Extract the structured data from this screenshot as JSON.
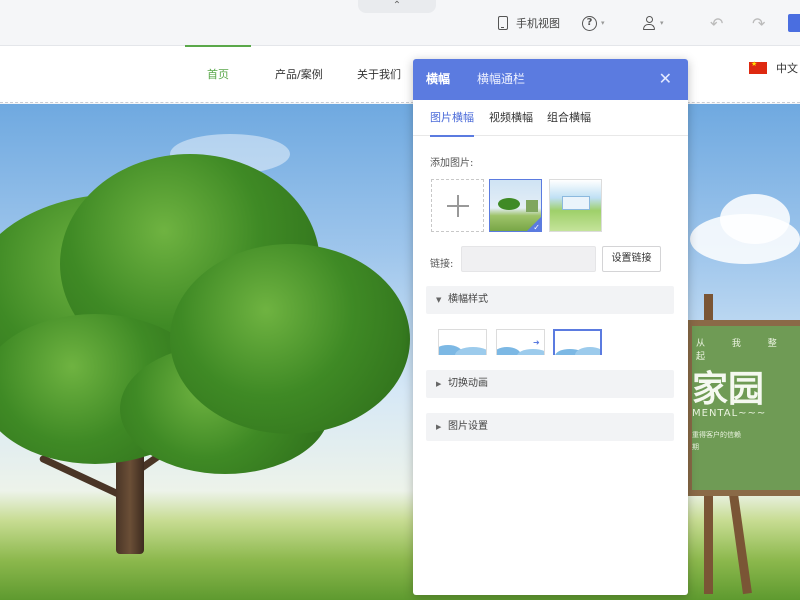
{
  "toolbar": {
    "collapse_glyph": "⌃",
    "mobile_view": "手机视图",
    "help_glyph": "?",
    "caret": "▾",
    "undo_glyph": "↶",
    "redo_glyph": "↷"
  },
  "site": {
    "nav": {
      "home": "首页",
      "products": "产品/案例",
      "about": "关于我们"
    },
    "language": "中文"
  },
  "banner": {
    "board_ticks": "从 我 整 起",
    "board_title": "家园",
    "board_en": "MENTAL~~~",
    "board_line1": "重得客户的信赖",
    "board_line2": "期"
  },
  "panel": {
    "tabs": [
      "横幅",
      "横幅通栏"
    ],
    "close_glyph": "✕",
    "sub_tabs": [
      "图片横幅",
      "视频横幅",
      "组合横幅"
    ],
    "add_image_label": "添加图片:",
    "check_glyph": "✓",
    "link_label": "链接:",
    "link_value": "",
    "link_button": "设置链接",
    "sections": {
      "style": "横幅样式",
      "animation": "切换动画",
      "image_settings": "图片设置"
    },
    "expanded_arrow": "▼",
    "collapsed_arrow": "▶"
  },
  "colors": {
    "accent": "#5b7be0",
    "nav_active": "#5aa84a"
  },
  "icons": {
    "mobile": "mobile-phone-icon",
    "help": "help-circle-icon",
    "user": "user-icon",
    "undo": "undo-icon",
    "redo": "redo-icon",
    "flag": "china-flag-icon",
    "close": "close-icon",
    "add": "plus-icon"
  }
}
